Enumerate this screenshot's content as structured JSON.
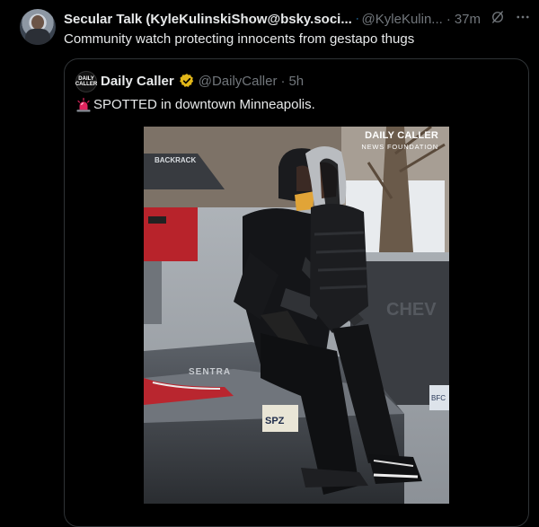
{
  "tweet": {
    "author_name": "Secular Talk (KyleKulinskiShow@bsky.soci...",
    "author_handle": "@KyleKulin...",
    "separator": "·",
    "time": "37m",
    "text": "Community watch protecting innocents from gestapo thugs"
  },
  "quote": {
    "avatar_text": "DAILY CALLER",
    "author_name": "Daily Caller",
    "author_handle": "@DailyCaller",
    "separator": "·",
    "time": "5h",
    "text": "SPOTTED in downtown Minneapolis.",
    "watermark_line1": "DAILY CALLER",
    "watermark_line2": "NEWS FOUNDATION",
    "photo_text": {
      "truck_rack": "BACKRACK",
      "car_model": "SENTRA",
      "truck_brand": "CHEV",
      "plate_left": "SPZ",
      "plate_right": "BFC"
    }
  },
  "colors": {
    "background": "#000000",
    "text_primary": "#e7e9ea",
    "text_secondary": "#71767b",
    "border": "#2f3336",
    "verified_blue": "#1d9bf0",
    "verified_gold": "#e2b719"
  },
  "icons": {
    "verified": "verified-badge-icon",
    "grok": "grok-icon",
    "more": "more-icon",
    "siren": "siren-emoji-icon"
  }
}
